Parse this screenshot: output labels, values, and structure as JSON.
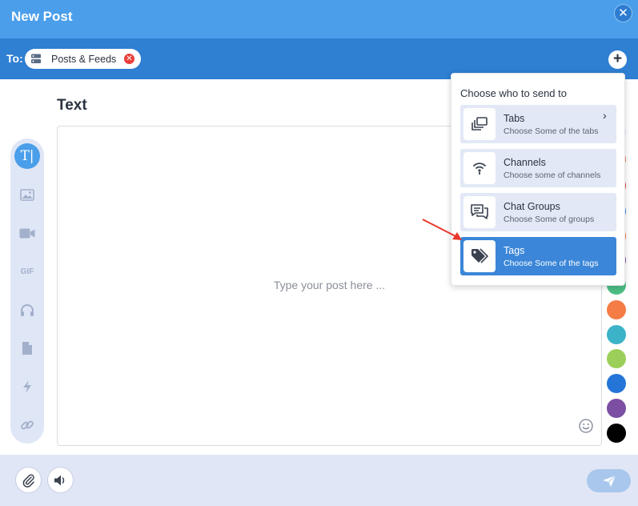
{
  "window": {
    "title": "New Post",
    "close_icon": "close-icon"
  },
  "to_bar": {
    "label": "To:",
    "chip": {
      "label": "Posts & Feeds",
      "icon": "server-icon"
    },
    "add_icon": "plus-icon"
  },
  "editor": {
    "heading": "Text",
    "placeholder": "Type your post here ..."
  },
  "toolbar": {
    "tools": [
      "text",
      "image",
      "video",
      "gif",
      "audio",
      "file",
      "lightning",
      "link"
    ],
    "active": "text",
    "text_tool_glyph": "T|",
    "gif_label": "GIF"
  },
  "colors": {
    "swatches": [
      "#f57c45",
      "#3db3c9",
      "#9ccf5a",
      "#2575d8",
      "#7c4fa3",
      "#000000"
    ]
  },
  "dropdown": {
    "title": "Choose who to send to",
    "options": [
      {
        "label": "Tabs",
        "sub": "Choose Some of the tabs",
        "icon": "tabs-icon"
      },
      {
        "label": "Channels",
        "sub": "Choose some of channels",
        "icon": "broadcast-icon"
      },
      {
        "label": "Chat Groups",
        "sub": "Choose Some of groups",
        "icon": "chat-icon"
      },
      {
        "label": "Tags",
        "sub": "Choose Some of the tags",
        "icon": "tag-icon"
      }
    ],
    "selected": "Tags"
  },
  "footer": {
    "attach_icon": "paperclip-icon",
    "audio_icon": "speaker-icon",
    "send_icon": "send-icon"
  },
  "accent": "#4a9eea"
}
